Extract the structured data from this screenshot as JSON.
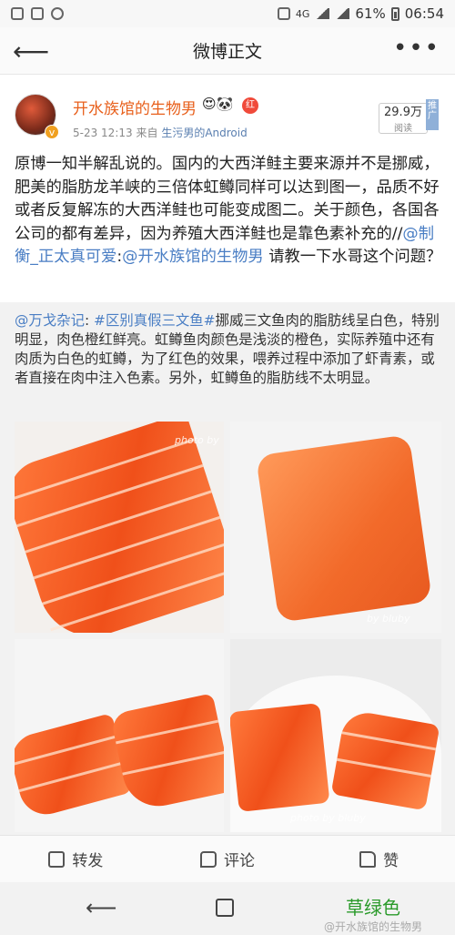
{
  "status_bar": {
    "network": "4G",
    "battery": "61%",
    "time": "06:54"
  },
  "nav": {
    "title": "微博正文"
  },
  "author": {
    "name": "开水族馆的生物男",
    "emoji": "😍🐼",
    "badge_text": "红",
    "verified": "v"
  },
  "meta": {
    "date": "5-23 12:13",
    "from_label": "来自",
    "source": "生污男的Android"
  },
  "reads": {
    "count": "29.9万",
    "label": "阅读",
    "promote": "推广"
  },
  "main_post": {
    "text": "原博一知半解乱说的。国内的大西洋鲑主要来源并不是挪威，肥美的脂肪龙羊峡的三倍体虹鳟同样可以达到图一，品质不好或者反复解冻的大西洋鲑也可能变成图二。关于颜色，各国各公司的都有差异，因为养殖大西洋鲑也是靠色素补充的//",
    "mention1": "@制衡_正太真可爱",
    "colon": ":",
    "mention2": "@开水族馆的生物男",
    "tail": " 请教一下水哥这个问题？"
  },
  "retweet": {
    "mention": "@万戈杂记",
    "colon": ": ",
    "hashtag": "#区别真假三文鱼#",
    "text": "挪威三文鱼肉的脂肪线呈白色，特别明显，肉色橙红鲜亮。虹鳟鱼肉颜色是浅淡的橙色，实际养殖中还有肉质为白色的虹鳟，为了红色的效果，喂养过程中添加了虾青素，或者直接在肉中注入色素。另外，虹鳟鱼的脂肪线不太明显。",
    "watermark1": "photo by",
    "watermark2": "by bluby",
    "watermark3": "photo by bluby"
  },
  "actions": {
    "repost": "转发",
    "comment": "评论",
    "like": "赞"
  },
  "overlay": {
    "green_label": "草绿色",
    "weibo_watermark": "@开水族馆的生物男"
  },
  "colors": {
    "accent_orange": "#e8601c",
    "link_blue": "#4a7ec4",
    "green_label": "#2a9a2a"
  }
}
